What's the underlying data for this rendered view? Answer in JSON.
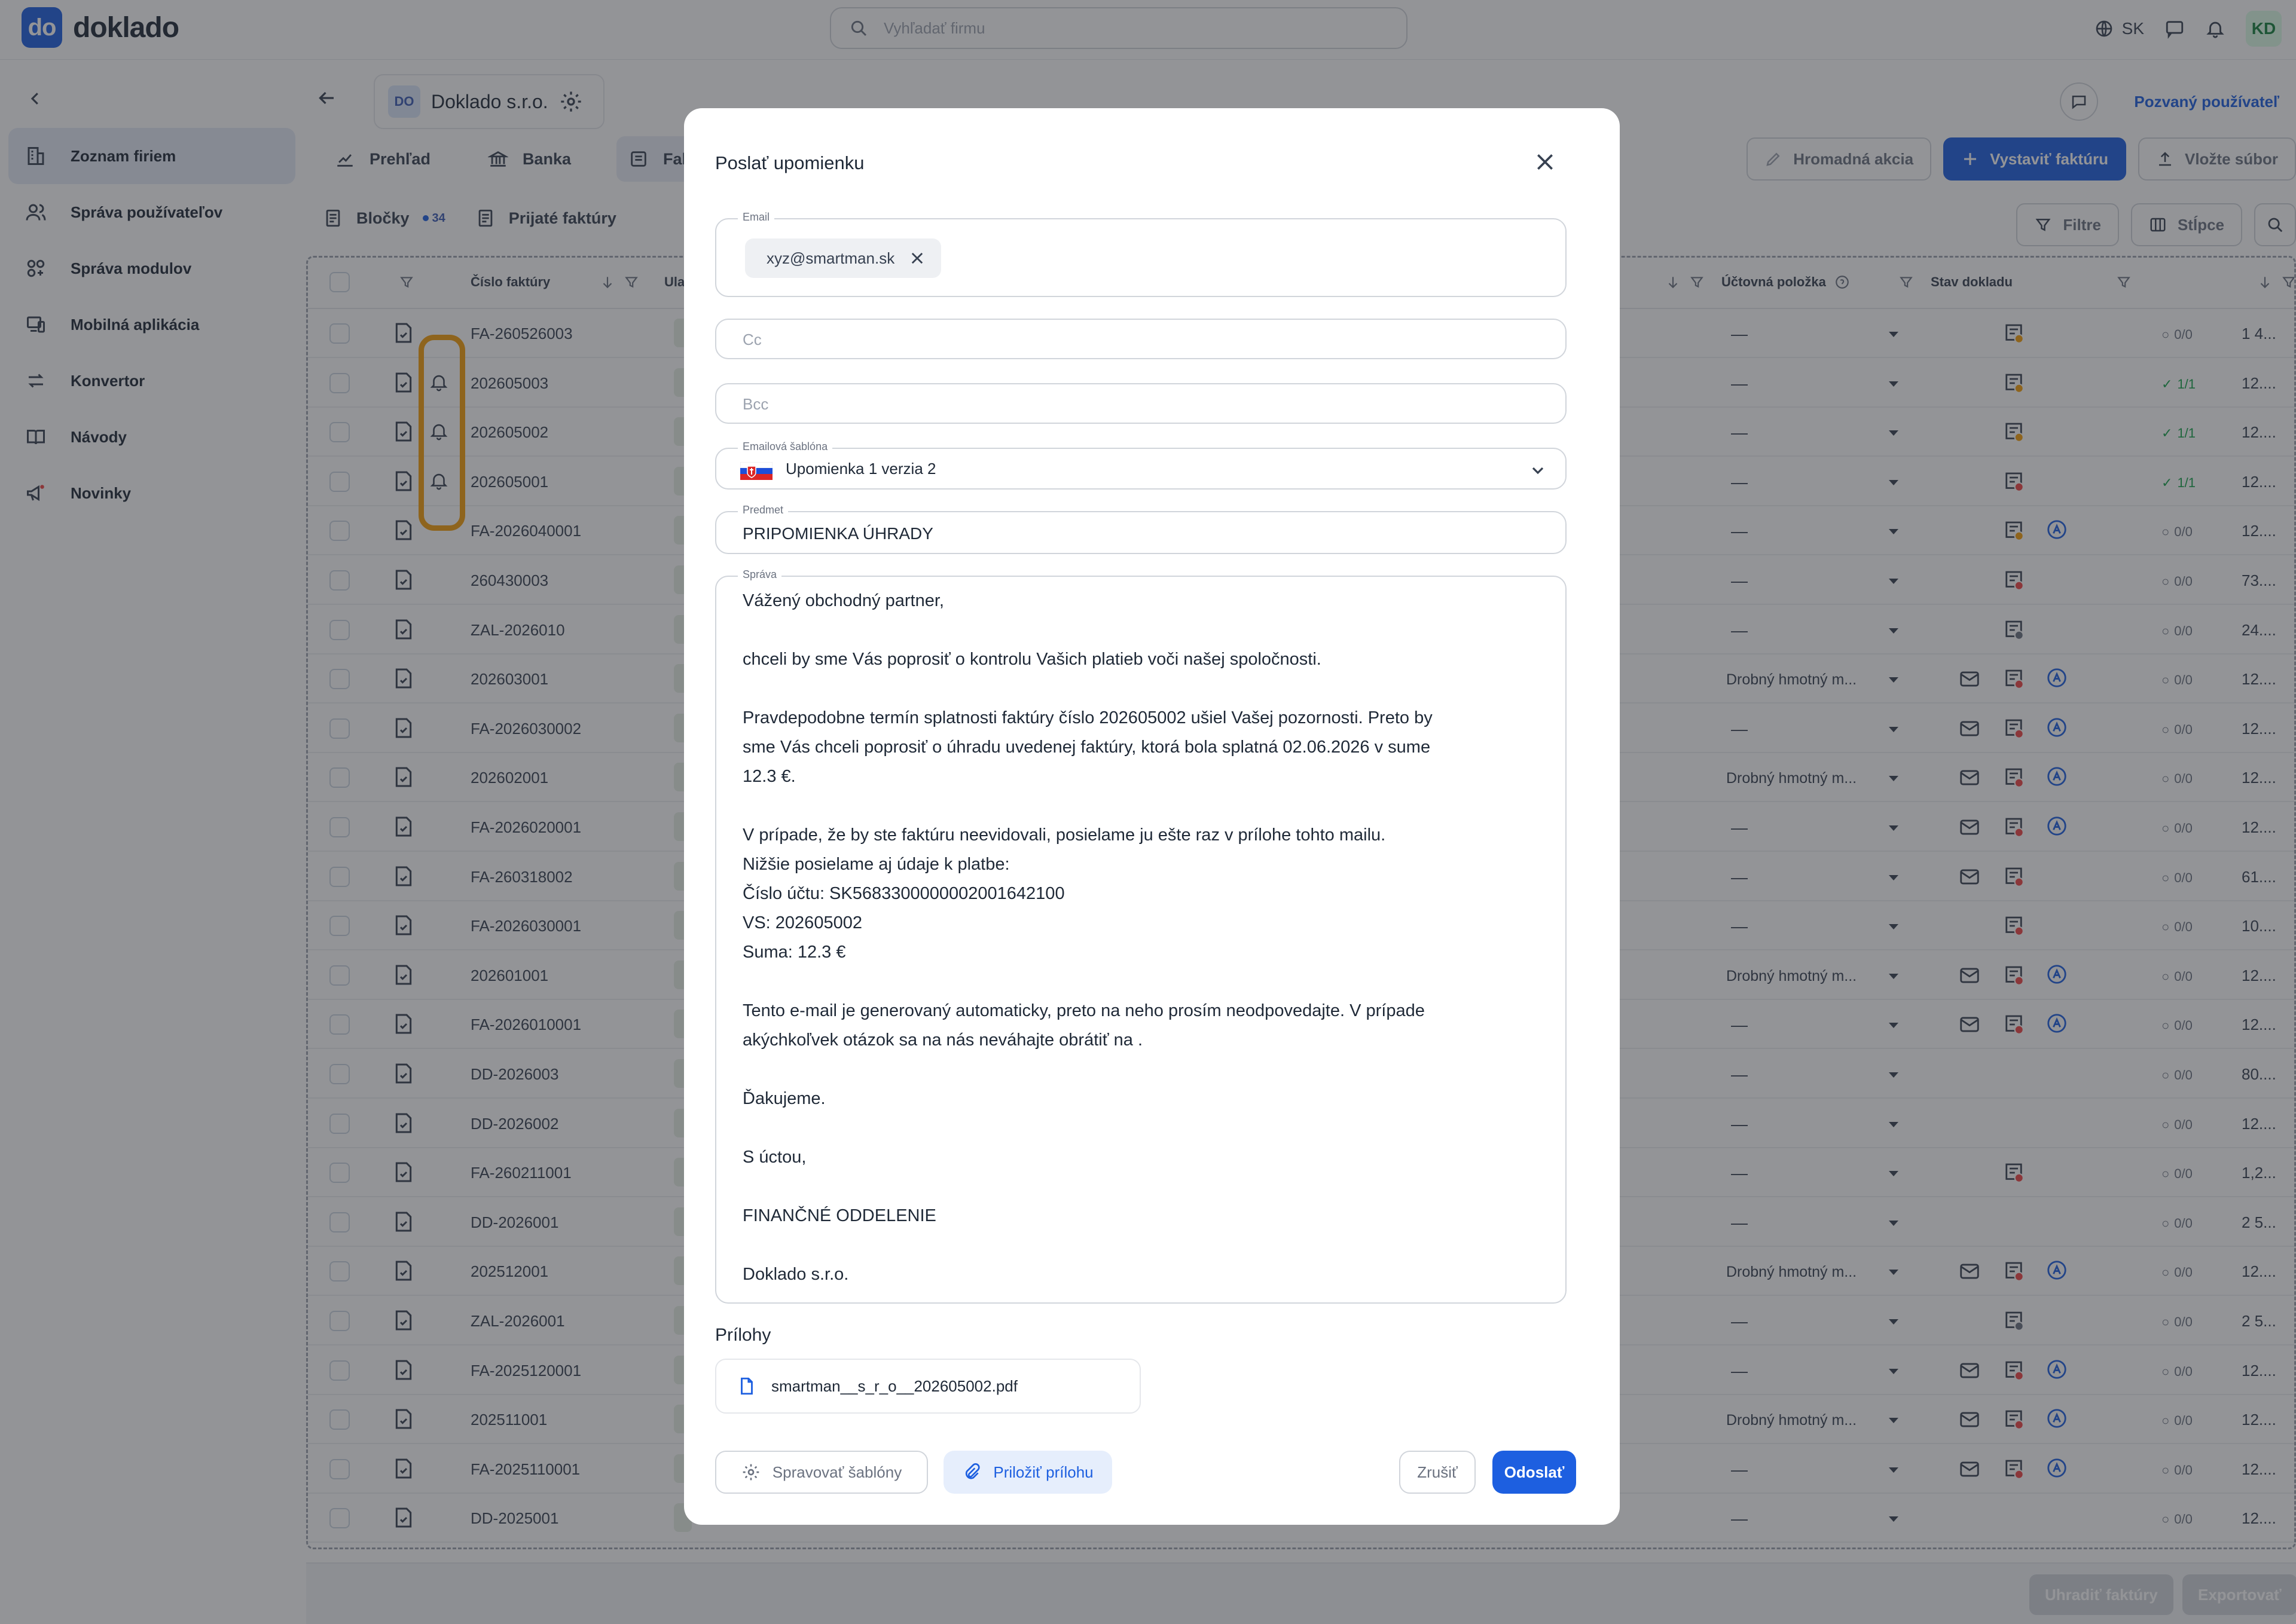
{
  "app": {
    "logo_text": "do",
    "logo_word": "doklado",
    "search_placeholder": "Vyhľadať firmu",
    "lang": "SK",
    "avatar": "KD"
  },
  "sidebar": {
    "items": [
      {
        "label": "Zoznam firiem",
        "icon": "building-icon",
        "active": true
      },
      {
        "label": "Správa používateľov",
        "icon": "users-icon"
      },
      {
        "label": "Správa modulov",
        "icon": "modules-icon"
      },
      {
        "label": "Mobilná aplikácia",
        "icon": "mobile-icon"
      },
      {
        "label": "Konvertor",
        "icon": "convert-icon"
      },
      {
        "label": "Návody",
        "icon": "book-icon"
      },
      {
        "label": "Novinky",
        "icon": "megaphone-icon"
      }
    ]
  },
  "company": {
    "badge": "DO",
    "name": "Doklado s.r.o."
  },
  "header_link": "Pozvaný používateľ",
  "tabs": [
    {
      "label": "Prehľad"
    },
    {
      "label": "Banka"
    },
    {
      "label": "Faktúry"
    }
  ],
  "toolbar": {
    "bulk": "Hromadná akcia",
    "issue": "Vystaviť faktúru",
    "upload": "Vložte súbor",
    "filters": "Filtre",
    "columns": "Stĺpce"
  },
  "subtabs": [
    {
      "label": "Bločky",
      "count": "34"
    },
    {
      "label": "Prijaté faktúry"
    }
  ],
  "table": {
    "headers": {
      "number": "Číslo faktúry",
      "fourth": "Ula",
      "account_item": "Účtovná položka",
      "doc_state": "Stav dokladu"
    },
    "rows": [
      {
        "num": "FA-260526003",
        "acc": "—",
        "cnt": "0/0",
        "sum": "1 4...",
        "bell": false,
        "mail": false,
        "a": false,
        "sc": "#f59e0b"
      },
      {
        "num": "202605003",
        "acc": "—",
        "cnt": "1/1",
        "sum": "12....",
        "bell": true,
        "ok": true,
        "sc": "#f59e0b"
      },
      {
        "num": "202605002",
        "acc": "—",
        "cnt": "1/1",
        "sum": "12....",
        "bell": true,
        "ok": true,
        "sc": "#f59e0b"
      },
      {
        "num": "202605001",
        "acc": "—",
        "cnt": "1/1",
        "sum": "12....",
        "bell": true,
        "ok": true,
        "sc": "#ef4444"
      },
      {
        "num": "FA-2026040001",
        "acc": "—",
        "cnt": "0/0",
        "sum": "12....",
        "a": true,
        "sc": "#f59e0b"
      },
      {
        "num": "260430003",
        "acc": "—",
        "cnt": "0/0",
        "sum": "73....",
        "sc": "#ef4444"
      },
      {
        "num": "ZAL-2026010",
        "acc": "—",
        "cnt": "0/0",
        "sum": "24....",
        "sc": "#6b7280"
      },
      {
        "num": "202603001",
        "acc": "Drobný hmotný m...",
        "cnt": "0/0",
        "sum": "12....",
        "mail": true,
        "a": true,
        "sc": "#ef4444"
      },
      {
        "num": "FA-2026030002",
        "acc": "—",
        "cnt": "0/0",
        "sum": "12....",
        "mail": true,
        "a": true,
        "sc": "#ef4444"
      },
      {
        "num": "202602001",
        "acc": "Drobný hmotný m...",
        "cnt": "0/0",
        "sum": "12....",
        "mail": true,
        "a": true,
        "sc": "#ef4444"
      },
      {
        "num": "FA-2026020001",
        "acc": "—",
        "cnt": "0/0",
        "sum": "12....",
        "mail": true,
        "a": true,
        "sc": "#ef4444"
      },
      {
        "num": "FA-260318002",
        "acc": "—",
        "cnt": "0/0",
        "sum": "61....",
        "mail": true,
        "sc": "#ef4444"
      },
      {
        "num": "FA-2026030001",
        "acc": "—",
        "cnt": "0/0",
        "sum": "10....",
        "sc": "#ef4444"
      },
      {
        "num": "202601001",
        "acc": "Drobný hmotný m...",
        "cnt": "0/0",
        "sum": "12....",
        "mail": true,
        "a": true,
        "sc": "#ef4444"
      },
      {
        "num": "FA-2026010001",
        "acc": "—",
        "cnt": "0/0",
        "sum": "12....",
        "mail": true,
        "a": true,
        "sc": "#ef4444"
      },
      {
        "num": "DD-2026003",
        "acc": "—",
        "cnt": "0/0",
        "sum": "80...."
      },
      {
        "num": "DD-2026002",
        "acc": "—",
        "cnt": "0/0",
        "sum": "12...."
      },
      {
        "num": "FA-260211001",
        "acc": "—",
        "cnt": "0/0",
        "sum": "1,2...",
        "sc": "#ef4444"
      },
      {
        "num": "DD-2026001",
        "acc": "—",
        "cnt": "0/0",
        "sum": "2 5..."
      },
      {
        "num": "202512001",
        "acc": "Drobný hmotný m...",
        "cnt": "0/0",
        "sum": "12....",
        "mail": true,
        "a": true,
        "sc": "#ef4444"
      },
      {
        "num": "ZAL-2026001",
        "acc": "—",
        "cnt": "0/0",
        "sum": "2 5...",
        "sc": "#6b7280"
      },
      {
        "num": "FA-2025120001",
        "acc": "—",
        "cnt": "0/0",
        "sum": "12....",
        "mail": true,
        "a": true,
        "sc": "#ef4444"
      },
      {
        "num": "202511001",
        "acc": "Drobný hmotný m...",
        "cnt": "0/0",
        "sum": "12....",
        "mail": true,
        "a": true,
        "sc": "#ef4444"
      },
      {
        "num": "FA-2025110001",
        "acc": "—",
        "cnt": "0/0",
        "sum": "12....",
        "mail": true,
        "a": true,
        "sc": "#ef4444"
      },
      {
        "num": "DD-2025001",
        "acc": "—",
        "cnt": "0/0",
        "sum": "12...."
      }
    ]
  },
  "bottom": {
    "pay": "Uhradiť faktúry",
    "export": "Exportovať"
  },
  "modal": {
    "title": "Poslať upomienku",
    "email_label": "Email",
    "email_chip": "xyz@smartman.sk",
    "cc_placeholder": "Cc",
    "bcc_placeholder": "Bcc",
    "template_label": "Emailová šablóna",
    "template_value": "Upomienka 1 verzia 2",
    "subject_label": "Predmet",
    "subject_value": "PRIPOMIENKA ÚHRADY",
    "message_label": "Správa",
    "message_lines": [
      "Vážený obchodný partner,",
      "",
      "chceli by sme Vás poprosiť o kontrolu Vašich platieb voči našej spoločnosti.",
      "",
      "Pravdepodobne termín splatnosti faktúry číslo 202605002 ušiel Vašej pozornosti. Preto by",
      "sme Vás chceli poprosiť o úhradu uvedenej faktúry, ktorá bola splatná 02.06.2026 v sume",
      "12.3 €.",
      "",
      "V prípade, že by ste faktúru neevidovali, posielame ju ešte raz v prílohe tohto mailu.",
      "Nižšie posielame aj údaje k platbe:",
      "Číslo účtu: SK5683300000002001642100",
      "VS: 202605002",
      "Suma: 12.3 €",
      "",
      "Tento e-mail je generovaný automaticky, preto na neho prosím neodpovedajte. V prípade",
      "akýchkoľvek otázok sa na nás neváhajte obrátiť na .",
      "",
      "Ďakujeme.",
      "",
      "S úctou,",
      "",
      "FINANČNÉ ODDELENIE",
      "",
      "Doklado s.r.o."
    ],
    "attachments_title": "Prílohy",
    "attachment_file": "smartman__s_r_o__202605002.pdf",
    "manage_templates": "Spravovať šablóny",
    "attach_button": "Priložiť prílohu",
    "cancel": "Zrušiť",
    "send": "Odoslať"
  },
  "colors": {
    "accent": "#1d5fe0",
    "highlight": "#f59e0b",
    "ok": "#16a34a",
    "alert": "#ef4444"
  }
}
